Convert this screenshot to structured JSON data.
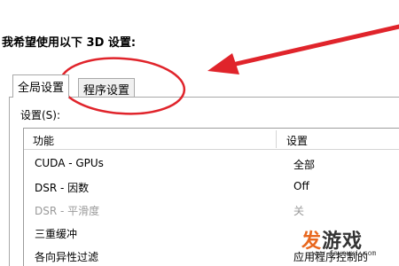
{
  "heading": "我希望使用以下 3D 设置:",
  "tabs": {
    "global": "全局设置",
    "program": "程序设置"
  },
  "panel": {
    "settings_label": "设置(S):"
  },
  "grid": {
    "header_feature": "功能",
    "header_setting": "设置",
    "rows": [
      {
        "feature": "CUDA - GPUs",
        "setting": "全部",
        "disabled": false
      },
      {
        "feature": "DSR - 因数",
        "setting": "Off",
        "disabled": false
      },
      {
        "feature": "DSR - 平滑度",
        "setting": "关",
        "disabled": true
      },
      {
        "feature": "三重缓冲",
        "setting": "",
        "disabled": false
      },
      {
        "feature": "各向异性过滤",
        "setting": "应用程序控制的",
        "disabled": false
      }
    ]
  },
  "watermark": {
    "fa": "发",
    "game": "游戏",
    "url": "www.fayouxi.com"
  },
  "colors": {
    "annotation_red": "#e0242b",
    "watermark_orange": "#e8681f"
  }
}
